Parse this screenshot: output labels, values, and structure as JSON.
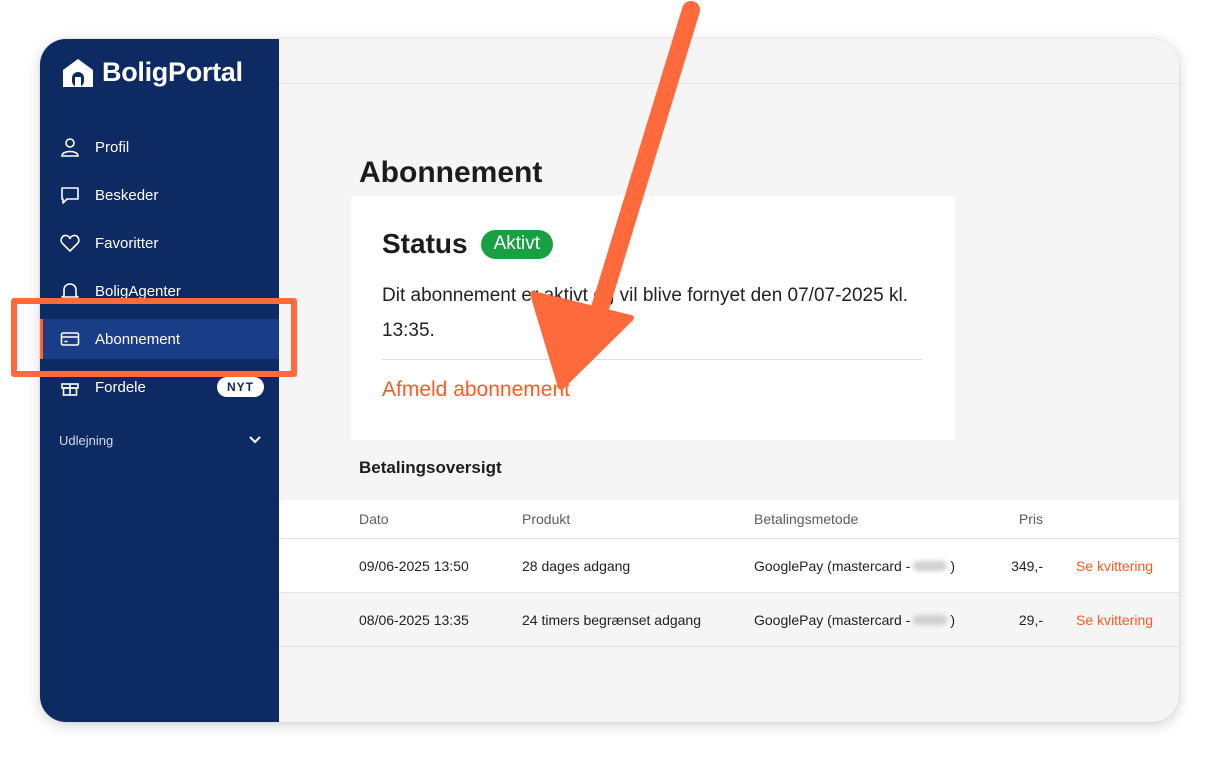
{
  "brand": {
    "name": "BoligPortal",
    "logo_icon": "house-logo-icon"
  },
  "sidebar": {
    "items": [
      {
        "label": "Profil",
        "icon": "user-icon"
      },
      {
        "label": "Beskeder",
        "icon": "chat-icon"
      },
      {
        "label": "Favoritter",
        "icon": "heart-icon"
      },
      {
        "label": "BoligAgenter",
        "icon": "bell-icon"
      },
      {
        "label": "Abonnement",
        "icon": "card-icon",
        "active": true
      },
      {
        "label": "Fordele",
        "icon": "gift-icon",
        "badge": "NYT"
      }
    ],
    "section": {
      "label": "Udlejning",
      "icon": "chevron-down-icon"
    }
  },
  "main": {
    "title": "Abonnement",
    "status_card": {
      "title": "Status",
      "badge": "Aktivt",
      "description": "Dit abonnement er aktivt og vil blive fornyet den 07/07-2025 kl. 13:35.",
      "cancel_link": "Afmeld abonnement"
    },
    "payments": {
      "title": "Betalingsoversigt",
      "columns": [
        "Dato",
        "Produkt",
        "Betalingsmetode",
        "Pris"
      ],
      "rows": [
        {
          "date": "09/06-2025 13:50",
          "product": "28 dages adgang",
          "method": "GooglePay (mastercard -",
          "method_end": ")",
          "price": "349,-",
          "action": "Se kvittering"
        },
        {
          "date": "08/06-2025 13:35",
          "product": "24 timers begrænset adgang",
          "method": "GooglePay (mastercard -",
          "method_end": ")",
          "price": "29,-",
          "action": "Se kvittering"
        }
      ]
    }
  },
  "colors": {
    "sidebar_bg": "#0e2a62",
    "sidebar_active": "#1a3d87",
    "accent": "#ff5a1f",
    "status_green": "#19a043",
    "annotation": "#ff6a3d"
  }
}
